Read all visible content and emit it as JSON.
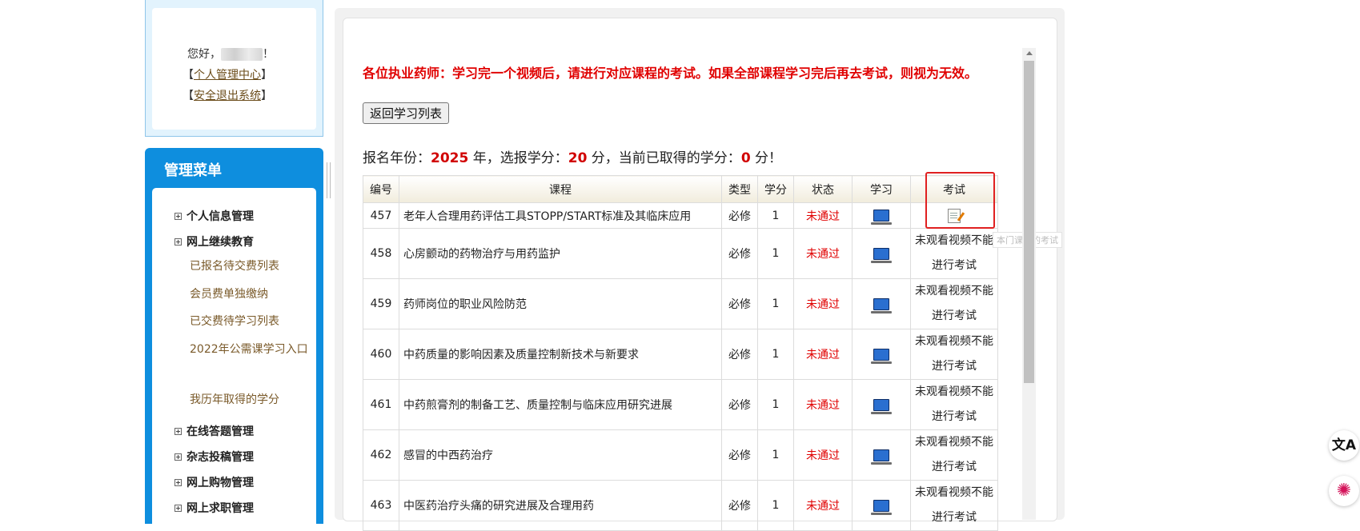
{
  "user_panel": {
    "greeting": "您好，",
    "greeting_end": "！",
    "personal_center": "个人管理中心",
    "logout": "安全退出系统",
    "bracket_open": "【",
    "bracket_close": "】"
  },
  "menu": {
    "title": "管理菜单",
    "items": [
      {
        "label": "个人信息管理"
      },
      {
        "label": "网上继续教育"
      },
      {
        "label": "在线答题管理"
      },
      {
        "label": "杂志投稿管理"
      },
      {
        "label": "网上购物管理"
      },
      {
        "label": "网上求职管理"
      }
    ],
    "subitems": [
      {
        "label": "已报名待交费列表"
      },
      {
        "label": "会员费单独缴纳"
      },
      {
        "label": "已交费待学习列表"
      },
      {
        "label": "2022年公需课学习入口"
      },
      {
        "label": "我历年取得的学分"
      }
    ]
  },
  "notice": "各位执业药师：学习完一个视频后，请进行对应课程的考试。如果全部课程学习完后再去考试，则视为无效。",
  "back_button": "返回学习列表",
  "summary": {
    "prefix": "报名年份：",
    "year": "2025",
    "mid1": " 年，选报学分：",
    "selected_credits": "20",
    "mid2": " 分，当前已取得的学分：",
    "earned_credits": "0",
    "suffix": " 分！"
  },
  "table": {
    "headers": {
      "id": "编号",
      "course": "课程",
      "type": "类型",
      "credit": "学分",
      "status": "状态",
      "study": "学习",
      "exam": "考试"
    },
    "rows": [
      {
        "id": "457",
        "course": "老年人合理用药评估工具STOPP/START标准及其临床应用",
        "type": "必修",
        "credit": "1",
        "status": "未通过",
        "exam": ""
      },
      {
        "id": "458",
        "course": "心房颤动的药物治疗与用药监护",
        "type": "必修",
        "credit": "1",
        "status": "未通过",
        "exam": "未观看视频不能进行考试"
      },
      {
        "id": "459",
        "course": "药师岗位的职业风险防范",
        "type": "必修",
        "credit": "1",
        "status": "未通过",
        "exam": "未观看视频不能进行考试"
      },
      {
        "id": "460",
        "course": "中药质量的影响因素及质量控制新技术与新要求",
        "type": "必修",
        "credit": "1",
        "status": "未通过",
        "exam": "未观看视频不能进行考试"
      },
      {
        "id": "461",
        "course": "中药煎膏剂的制备工艺、质量控制与临床应用研究进展",
        "type": "必修",
        "credit": "1",
        "status": "未通过",
        "exam": "未观看视频不能进行考试"
      },
      {
        "id": "462",
        "course": "感冒的中西药治疗",
        "type": "必修",
        "credit": "1",
        "status": "未通过",
        "exam": "未观看视频不能进行考试"
      },
      {
        "id": "463",
        "course": "中医药治疗头痛的研究进展及合理用药",
        "type": "必修",
        "credit": "1",
        "status": "未通过",
        "exam": "未观看视频不能进行考试"
      }
    ]
  },
  "tooltip": "本门课程的考试",
  "icons": {
    "study": "computer-icon",
    "exam": "exam-paper-icon",
    "translate": "translate-icon",
    "assistant": "ai-assistant-icon"
  },
  "floating": {
    "translate_glyph": "文A",
    "assistant_glyph": "✺"
  }
}
